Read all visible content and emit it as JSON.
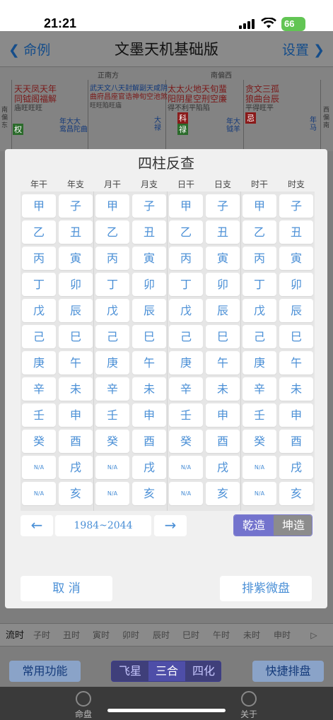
{
  "status": {
    "time": "21:21",
    "battery": "66"
  },
  "navbar": {
    "back_label": "命例",
    "title": "文墨天机基础版",
    "settings_label": "设置"
  },
  "chart_bg": {
    "dir_top1": "正南方",
    "dir_top2": "南偏西",
    "dir_left": "南偏东",
    "dir_right": "西偏南",
    "palace1_stars": "天天凤天年",
    "palace1_stars2": "同钺阁福解",
    "palace1_bright": "庙旺旺旺",
    "palace1_tag": "权",
    "palace1_misc": "年大大",
    "palace1_misc2": "鸾昌陀曲",
    "palace2_stars": "武天文八天封解副天咸阴",
    "palace2_stars2": "曲府昌座官诰神旬空池煞",
    "palace2_bright": "旺旺陷旺庙",
    "palace2_misc": "大禄",
    "palace3_stars": "太太火地天旬蜚",
    "palace3_stars2": "阳阴星空刑空廉",
    "palace3_bright": "得不利平陷陷",
    "palace3_tag1": "科",
    "palace3_tag2": "禄",
    "palace3_misc": "年大",
    "palace3_misc2": "钺羊",
    "palace4_stars": "贪文三孤",
    "palace4_stars2": "狼曲台辰",
    "palace4_bright": "平得旺平",
    "palace4_tag": "忌",
    "palace4_misc": "年马"
  },
  "modal": {
    "title": "四柱反查",
    "headers": [
      "年干",
      "年支",
      "月干",
      "月支",
      "日干",
      "日支",
      "时干",
      "时支"
    ],
    "stems": [
      "甲",
      "乙",
      "丙",
      "丁",
      "戊",
      "己",
      "庚",
      "辛",
      "壬",
      "癸",
      "N/A",
      "N/A"
    ],
    "branches": [
      "子",
      "丑",
      "寅",
      "卯",
      "辰",
      "巳",
      "午",
      "未",
      "申",
      "酉",
      "戌",
      "亥"
    ],
    "prev": "←",
    "range": "1984~2044",
    "next": "→",
    "gender_male": "乾造",
    "gender_female": "坤造",
    "cancel": "取 消",
    "confirm": "排紫微盘"
  },
  "hour_bar": [
    "流时",
    "子时",
    "丑时",
    "寅时",
    "卯时",
    "辰时",
    "巳时",
    "午时",
    "未时",
    "申时",
    "▷"
  ],
  "func_row": {
    "common": "常用功能",
    "seg": [
      "飞星",
      "三合",
      "四化"
    ],
    "quick": "快捷排盘"
  },
  "tabbar": {
    "tab1": "命盘",
    "tab2": "关于"
  }
}
